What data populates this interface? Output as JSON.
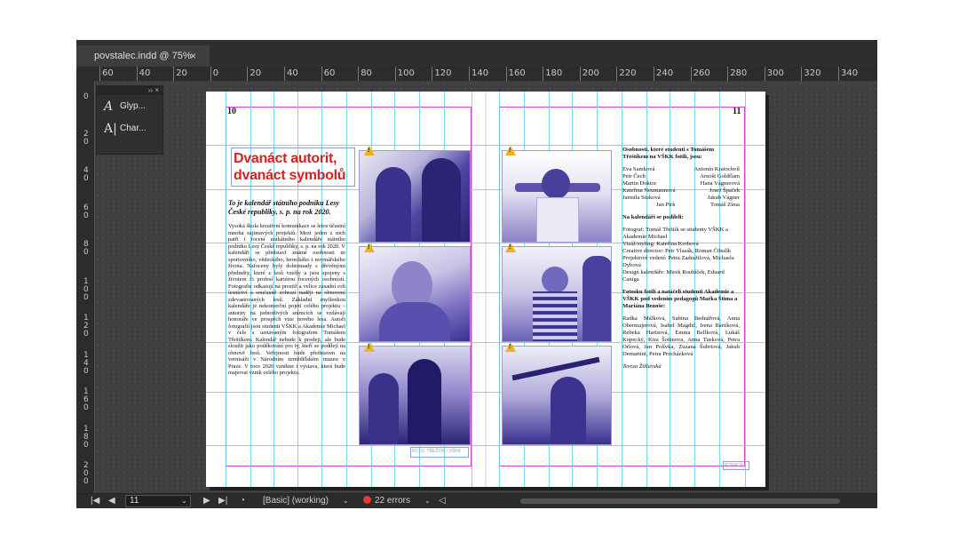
{
  "tab": {
    "title": "povstalec.indd @ 75%",
    "close": "×"
  },
  "ruler": {
    "h": [
      "60",
      "40",
      "20",
      "0",
      "20",
      "40",
      "60",
      "80",
      "100",
      "120",
      "140",
      "160",
      "180",
      "200",
      "220",
      "240",
      "260",
      "280",
      "300",
      "320",
      "340"
    ],
    "v": [
      "0",
      "20",
      "40",
      "60",
      "80",
      "100",
      "120",
      "140",
      "160",
      "180",
      "200"
    ]
  },
  "panel": {
    "glyphs_label": "Glyp...",
    "character_label": "Char...",
    "collapse": "›› ×"
  },
  "spread": {
    "left_page_number": "10",
    "right_page_number": "11",
    "heading": "Dvanáct autorit, dvanáct symbolů",
    "lead": "To je kalendář státního podniku Lesy České republiky, s. p. na rok 2020.",
    "body": "Vysoká škola kreativní komunikace se letos účastní mnoha zajímavých projektů. Mezi jeden z nich patří i focení unikátního kalendáře státního podniku Lesy České republiky, s. p. na rok 2020. V kalendáři se představí známé osobnosti ze sportovního, vědeckého, hereckého i novinářského života. Nafoceny byly dohromady s dřevěnými předměty, které z lesů vzešly a jsou spojeny s životem či profesí kariérou focených osobností. Fotografie odkazují na prestiž a velice zásadní roli lesníctví a současně zobrazí naději na obnovení zdevastovaných lesů. Základní myšlenkou kalendáře je nekomerční pojetí celého projektu – autority na jednotlivých snímcích se vzdávají honoráře ve prospěch vize nového lesa. Autoři fotografií jsou studenti VŠKK a Akademie Michael v čele s uznávaným fotografem Tomášem Třeštíkem. Kalendář nebude k prodeji, ale bude sloužit jako poděkování pro ty, kteří se podílejí na obnově lesů. Veřejnosti bude představen na vernisáži v Národním zemědělském muzeu v Praze. V roce 2020 vznikne i výstava, která bude mapovat vznik celého projektu.",
    "caption_left": "FOTO: TŘEŠTÍK / VŠKK",
    "caption_right": "PORADY",
    "right_intro": "Osobnosti, které studenti s Tomášem Třeštíkem na VŠKK fotili, jsou:",
    "names_left": [
      "Eva Samková",
      "Petr Čech",
      "Martin Doktor",
      "Kateřina Neumannová",
      "Jarmila Stuková",
      "Jan Pirk"
    ],
    "names_right": [
      "Antonín Kratochvíl",
      "Arnošt Goldflam",
      "Hana Vágnerová",
      "Josef Špaček",
      "Jakub Vágner",
      "Tomáš Zíma"
    ],
    "credits_heading": "Na kalendáři se podíleli:",
    "credits": [
      "Fotograf: Tomáš Třeštík se studenty VŠKK a Akademie Michael",
      "Vizáž/styling: Kateřina Krobová",
      "Creative director: Petr Vlasák, Roman Čibulík",
      "Projektové vedení: Petra Zadražilová, Michaela Dybová",
      "Design kalendáře: Mirek Roubíček, Eduard Caniga"
    ],
    "students_heading": "Fotosku fotili a natáčeli studenti Akademie a VŠKK pod vedením pedagogů Marka Štima a Mariána Benoše:",
    "students": "Radka Málková, Sabina Bednářová, Anna Obermajerová, Isabel Magdič, Irena Bártíková, Rebeka Harisová, Emma Bellková, Lukáš Kopecký, Kira Šošinova, Anna Tusková, Petra Orlová, Jan Polívka, Zuzana Šubrtová, Jakub Demartini, Petra Procházková",
    "signature": "Tereza Žižlavská"
  },
  "status": {
    "page": "11",
    "style": "[Basic] (working)",
    "errors": "22 errors"
  },
  "colors": {
    "heading": "#d92020",
    "guides": "#5dd6e3",
    "margins": "#d043d0",
    "duotone": "#4b3fa0",
    "error": "#e03a3a"
  },
  "icons": [
    "close-icon",
    "glyphs-icon",
    "character-icon",
    "first-page-icon",
    "prev-page-icon",
    "next-page-icon",
    "last-page-icon",
    "preflight-icon",
    "warning-icon"
  ]
}
